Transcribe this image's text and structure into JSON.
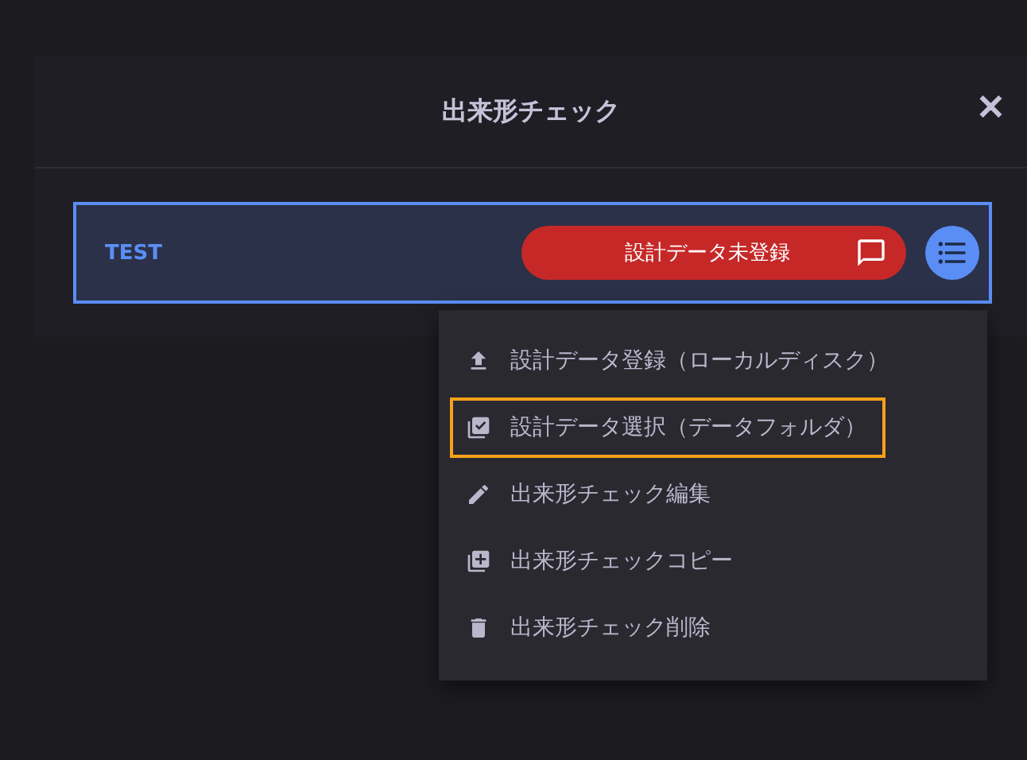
{
  "dialog": {
    "title": "出来形チェック",
    "close": "✕"
  },
  "card": {
    "name": "TEST",
    "status": "設計データ未登録",
    "selected": true
  },
  "menu": {
    "items": [
      {
        "label": "設計データ登録（ローカルディスク）",
        "kind": "upload",
        "selected": false
      },
      {
        "label": "設計データ選択（データフォルダ）",
        "kind": "select",
        "selected": true
      },
      {
        "label": "出来形チェック編集",
        "kind": "edit",
        "selected": false
      },
      {
        "label": "出来形チェックコピー",
        "kind": "copy",
        "selected": false
      },
      {
        "label": "出来形チェック削除",
        "kind": "delete",
        "selected": false
      }
    ]
  }
}
